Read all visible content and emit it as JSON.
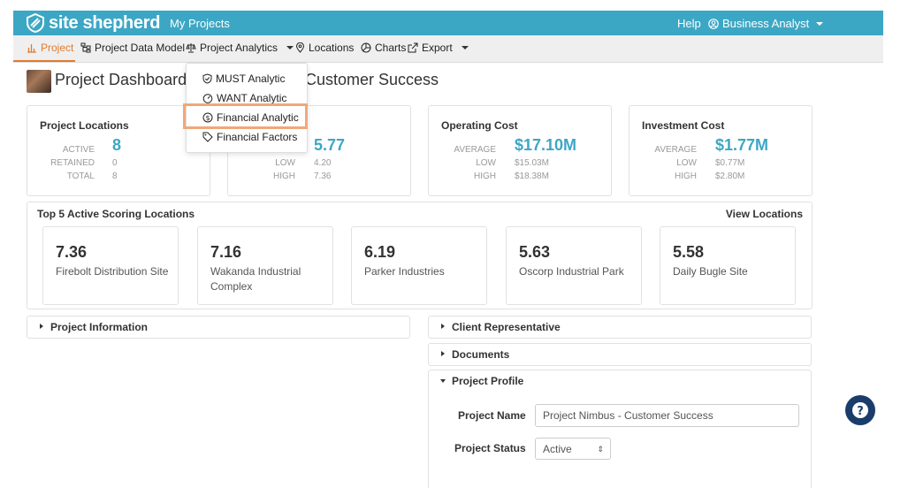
{
  "header": {
    "logo_text": "site shepherd",
    "my_projects": "My Projects",
    "help": "Help",
    "user": "Business Analyst",
    "brand_color": "#3ca7c4"
  },
  "subnav": {
    "items": [
      {
        "label": "Project",
        "icon": "bar-chart-icon",
        "active": true
      },
      {
        "label": "Project Data Model",
        "icon": "sitemap-icon"
      },
      {
        "label": "Project Analytics",
        "icon": "scale-icon",
        "dropdown": true
      },
      {
        "label": "Locations",
        "icon": "map-pin-icon"
      },
      {
        "label": "Charts",
        "icon": "pie-chart-icon"
      },
      {
        "label": "Export",
        "icon": "export-icon",
        "dropdown": true
      }
    ],
    "active_color": "#e27a2f"
  },
  "page": {
    "title_left": "Project Dashboard |",
    "title_right": "Customer Success"
  },
  "analytics_menu": {
    "items": [
      {
        "label": "MUST Analytic",
        "icon": "shield-check-icon"
      },
      {
        "label": "WANT Analytic",
        "icon": "gauge-icon"
      },
      {
        "label": "Financial Analytic",
        "icon": "dollar-circle-icon",
        "highlighted": true
      },
      {
        "label": "Financial Factors",
        "icon": "tag-icon"
      }
    ],
    "highlight_color": "#f0a878"
  },
  "cards": {
    "locations": {
      "title": "Project Locations",
      "active_label": "ACTIVE",
      "active_value": "8",
      "retained_label": "RETAINED",
      "retained_value": "0",
      "total_label": "TOTAL",
      "total_value": "8"
    },
    "score": {
      "value": "5.77",
      "low_label": "LOW",
      "low_value": "4.20",
      "high_label": "HIGH",
      "high_value": "7.36"
    },
    "operating": {
      "title": "Operating Cost",
      "average_label": "AVERAGE",
      "average_value": "$17.10M",
      "low_label": "LOW",
      "low_value": "$15.03M",
      "high_label": "HIGH",
      "high_value": "$18.38M"
    },
    "investment": {
      "title": "Investment Cost",
      "average_label": "AVERAGE",
      "average_value": "$1.77M",
      "low_label": "LOW",
      "low_value": "$0.77M",
      "high_label": "HIGH",
      "high_value": "$2.80M"
    }
  },
  "top5": {
    "title": "Top 5 Active Scoring Locations",
    "view_link": "View Locations",
    "items": [
      {
        "score": "7.36",
        "name": "Firebolt Distribution Site"
      },
      {
        "score": "7.16",
        "name": "Wakanda Industrial Complex"
      },
      {
        "score": "6.19",
        "name": "Parker Industries"
      },
      {
        "score": "5.63",
        "name": "Oscorp Industrial Park"
      },
      {
        "score": "5.58",
        "name": "Daily Bugle Site"
      }
    ]
  },
  "panels": {
    "project_information": "Project Information",
    "client_representative": "Client Representative",
    "documents": "Documents",
    "project_profile": "Project Profile"
  },
  "profile_form": {
    "name_label": "Project Name",
    "name_value": "Project Nimbus - Customer Success",
    "status_label": "Project Status",
    "status_value": "Active"
  }
}
